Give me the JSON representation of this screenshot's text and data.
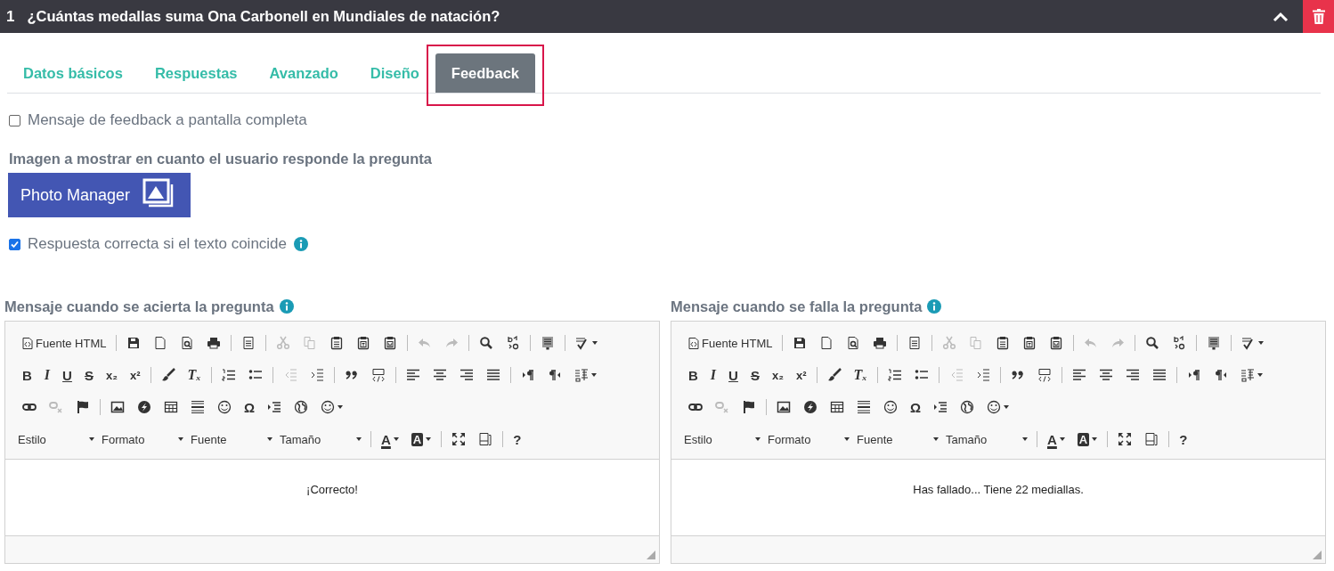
{
  "question": {
    "number": "1",
    "title": "¿Cuántas medallas suma Ona Carbonell en Mundiales de natación?",
    "expanded": true
  },
  "tabs": [
    {
      "label": "Datos básicos",
      "selected": false
    },
    {
      "label": "Respuestas",
      "selected": false
    },
    {
      "label": "Avanzado",
      "selected": false
    },
    {
      "label": "Diseño",
      "selected": false
    },
    {
      "label": "Feedback",
      "selected": true
    }
  ],
  "fullscreen_option": {
    "label": "Mensaje de feedback a pantalla completa",
    "checked": false
  },
  "image_section": {
    "label": "Imagen a mostrar en cuanto el usuario responde la pregunta",
    "button": "Photo Manager"
  },
  "match_option": {
    "label": "Respuesta correcta si el texto coincide",
    "checked": true
  },
  "editors": [
    {
      "label": "Mensaje cuando se acierta la pregunta",
      "content": "¡Correcto!",
      "toolbar": [
        [
          [
            {
              "kind": "source",
              "label": "Fuente HTML",
              "disabled": false
            }
          ],
          [
            {
              "kind": "save",
              "disabled": false
            },
            {
              "kind": "newpage",
              "disabled": false
            },
            {
              "kind": "preview",
              "disabled": false
            },
            {
              "kind": "print",
              "disabled": false
            }
          ],
          [
            {
              "kind": "templates",
              "disabled": false
            }
          ],
          [
            {
              "kind": "cut",
              "disabled": true
            },
            {
              "kind": "copy",
              "disabled": true
            },
            {
              "kind": "paste",
              "disabled": false
            },
            {
              "kind": "pastetext",
              "disabled": false
            },
            {
              "kind": "pasteword",
              "disabled": false
            }
          ],
          [
            {
              "kind": "undo",
              "disabled": true
            },
            {
              "kind": "redo",
              "disabled": true
            }
          ],
          [
            {
              "kind": "find",
              "disabled": false
            },
            {
              "kind": "replace",
              "disabled": false
            }
          ],
          [
            {
              "kind": "selectall",
              "disabled": false
            }
          ],
          [
            {
              "kind": "spellcheck",
              "disabled": false
            }
          ]
        ],
        [
          [
            {
              "kind": "bold",
              "label": "B",
              "disabled": false
            },
            {
              "kind": "italic",
              "label": "I",
              "disabled": false
            },
            {
              "kind": "underline",
              "label": "U",
              "disabled": false
            },
            {
              "kind": "strike",
              "label": "S",
              "disabled": false
            },
            {
              "kind": "subscript",
              "label": "x₂",
              "disabled": false
            },
            {
              "kind": "superscript",
              "label": "x²",
              "disabled": false
            }
          ],
          [
            {
              "kind": "brush",
              "disabled": false
            },
            {
              "kind": "removeformat",
              "label": "Tₓ",
              "disabled": false
            }
          ],
          [
            {
              "kind": "numlist",
              "disabled": false
            },
            {
              "kind": "bulletlist",
              "disabled": false
            }
          ],
          [
            {
              "kind": "outdent",
              "disabled": true
            },
            {
              "kind": "indent",
              "disabled": false
            }
          ],
          [
            {
              "kind": "blockquote",
              "disabled": false
            },
            {
              "kind": "creatediv",
              "disabled": false
            }
          ],
          [
            {
              "kind": "alignleft",
              "disabled": false
            },
            {
              "kind": "aligncenter",
              "disabled": false
            },
            {
              "kind": "alignright",
              "disabled": false
            },
            {
              "kind": "justify",
              "disabled": false
            }
          ],
          [
            {
              "kind": "ltr",
              "disabled": false
            },
            {
              "kind": "rtl",
              "disabled": false
            },
            {
              "kind": "language",
              "disabled": false
            }
          ]
        ],
        [
          [
            {
              "kind": "link",
              "disabled": false
            },
            {
              "kind": "unlink",
              "disabled": true
            },
            {
              "kind": "anchor",
              "disabled": false
            }
          ],
          [
            {
              "kind": "image",
              "disabled": false
            },
            {
              "kind": "flash",
              "disabled": false
            },
            {
              "kind": "table",
              "disabled": false
            },
            {
              "kind": "hr",
              "disabled": false
            },
            {
              "kind": "smiley",
              "disabled": false
            },
            {
              "kind": "specialchar",
              "label": "Ω",
              "disabled": false
            },
            {
              "kind": "pagebreak",
              "disabled": false
            },
            {
              "kind": "iframe",
              "disabled": false
            },
            {
              "kind": "emoji",
              "disabled": false
            }
          ]
        ],
        [
          [
            {
              "kind": "combo",
              "label": "Estilo",
              "disabled": false
            },
            {
              "kind": "combo",
              "label": "Formato",
              "disabled": false
            },
            {
              "kind": "combo",
              "label": "Fuente",
              "disabled": false
            },
            {
              "kind": "combo",
              "label": "Tamaño",
              "disabled": false
            }
          ],
          [
            {
              "kind": "textcolor",
              "label": "A",
              "disabled": false
            },
            {
              "kind": "bgcolor",
              "label": "A",
              "disabled": false
            }
          ],
          [
            {
              "kind": "maximize",
              "disabled": false
            },
            {
              "kind": "showblocks",
              "disabled": false
            }
          ],
          [
            {
              "kind": "about",
              "label": "?",
              "disabled": false
            }
          ]
        ]
      ]
    },
    {
      "label": "Mensaje cuando se falla la pregunta",
      "content": "Has fallado... Tiene 22 mediallas.",
      "toolbar": [
        [
          [
            {
              "kind": "source",
              "label": "Fuente HTML",
              "disabled": false
            }
          ],
          [
            {
              "kind": "save",
              "disabled": false
            },
            {
              "kind": "newpage",
              "disabled": false
            },
            {
              "kind": "preview",
              "disabled": false
            },
            {
              "kind": "print",
              "disabled": false
            }
          ],
          [
            {
              "kind": "templates",
              "disabled": false
            }
          ],
          [
            {
              "kind": "cut",
              "disabled": true
            },
            {
              "kind": "copy",
              "disabled": true
            },
            {
              "kind": "paste",
              "disabled": false
            },
            {
              "kind": "pastetext",
              "disabled": false
            },
            {
              "kind": "pasteword",
              "disabled": false
            }
          ],
          [
            {
              "kind": "undo",
              "disabled": true
            },
            {
              "kind": "redo",
              "disabled": true
            }
          ],
          [
            {
              "kind": "find",
              "disabled": false
            },
            {
              "kind": "replace",
              "disabled": false
            }
          ],
          [
            {
              "kind": "selectall",
              "disabled": false
            }
          ],
          [
            {
              "kind": "spellcheck",
              "disabled": false
            }
          ]
        ],
        [
          [
            {
              "kind": "bold",
              "label": "B",
              "disabled": false
            },
            {
              "kind": "italic",
              "label": "I",
              "disabled": false
            },
            {
              "kind": "underline",
              "label": "U",
              "disabled": false
            },
            {
              "kind": "strike",
              "label": "S",
              "disabled": false
            },
            {
              "kind": "subscript",
              "label": "x₂",
              "disabled": false
            },
            {
              "kind": "superscript",
              "label": "x²",
              "disabled": false
            }
          ],
          [
            {
              "kind": "brush",
              "disabled": false
            },
            {
              "kind": "removeformat",
              "label": "Tₓ",
              "disabled": false
            }
          ],
          [
            {
              "kind": "numlist",
              "disabled": false
            },
            {
              "kind": "bulletlist",
              "disabled": false
            }
          ],
          [
            {
              "kind": "outdent",
              "disabled": true
            },
            {
              "kind": "indent",
              "disabled": false
            }
          ],
          [
            {
              "kind": "blockquote",
              "disabled": false
            },
            {
              "kind": "creatediv",
              "disabled": false
            }
          ],
          [
            {
              "kind": "alignleft",
              "disabled": false
            },
            {
              "kind": "aligncenter",
              "disabled": false
            },
            {
              "kind": "alignright",
              "disabled": false
            },
            {
              "kind": "justify",
              "disabled": false
            }
          ],
          [
            {
              "kind": "ltr",
              "disabled": false
            },
            {
              "kind": "rtl",
              "disabled": false
            },
            {
              "kind": "language",
              "disabled": false
            }
          ]
        ],
        [
          [
            {
              "kind": "link",
              "disabled": false
            },
            {
              "kind": "unlink",
              "disabled": true
            },
            {
              "kind": "anchor",
              "disabled": false
            }
          ],
          [
            {
              "kind": "image",
              "disabled": false
            },
            {
              "kind": "flash",
              "disabled": false
            },
            {
              "kind": "table",
              "disabled": false
            },
            {
              "kind": "hr",
              "disabled": false
            },
            {
              "kind": "smiley",
              "disabled": false
            },
            {
              "kind": "specialchar",
              "label": "Ω",
              "disabled": false
            },
            {
              "kind": "pagebreak",
              "disabled": false
            },
            {
              "kind": "iframe",
              "disabled": false
            },
            {
              "kind": "emoji",
              "disabled": false
            }
          ]
        ],
        [
          [
            {
              "kind": "combo",
              "label": "Estilo",
              "disabled": false
            },
            {
              "kind": "combo",
              "label": "Formato",
              "disabled": false
            },
            {
              "kind": "combo",
              "label": "Fuente",
              "disabled": false
            },
            {
              "kind": "combo",
              "label": "Tamaño",
              "disabled": false
            }
          ],
          [
            {
              "kind": "textcolor",
              "label": "A",
              "disabled": false
            },
            {
              "kind": "bgcolor",
              "label": "A",
              "disabled": false
            }
          ],
          [
            {
              "kind": "maximize",
              "disabled": false
            },
            {
              "kind": "showblocks",
              "disabled": false
            }
          ],
          [
            {
              "kind": "about",
              "label": "?",
              "disabled": false
            }
          ]
        ]
      ]
    }
  ]
}
